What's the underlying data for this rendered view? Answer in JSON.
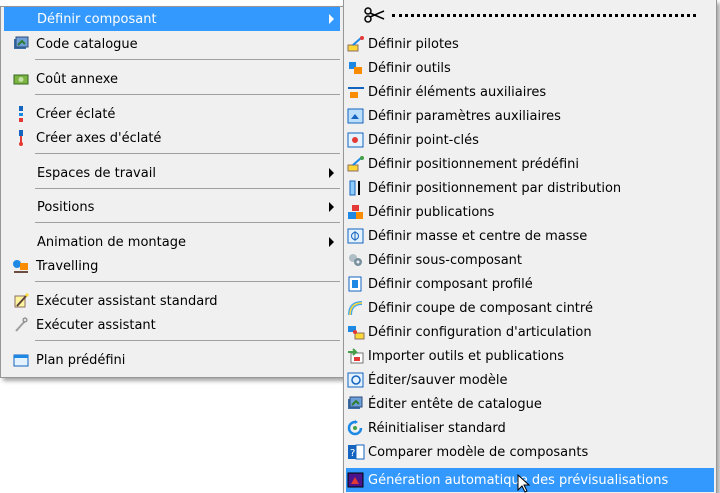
{
  "main_menu": {
    "items": [
      {
        "label": "Définir composant",
        "icon": "none",
        "submenu": true,
        "highlighted": true
      },
      {
        "label": "Code catalogue",
        "icon": "catalog-icon"
      },
      {
        "label": "Coût annexe",
        "icon": "money-icon"
      },
      {
        "label": "Créer éclaté",
        "icon": "explode-icon"
      },
      {
        "label": "Créer axes d'éclaté",
        "icon": "explode-axis-icon"
      },
      {
        "label": "Espaces de travail",
        "icon": "none",
        "submenu": true
      },
      {
        "label": "Positions",
        "icon": "none",
        "submenu": true
      },
      {
        "label": "Animation de montage",
        "icon": "none",
        "submenu": true
      },
      {
        "label": "Travelling",
        "icon": "travelling-icon"
      },
      {
        "label": "Exécuter assistant standard",
        "icon": "wizard-standard-icon"
      },
      {
        "label": "Exécuter assistant",
        "icon": "wizard-icon"
      },
      {
        "label": "Plan prédéfini",
        "icon": "plan-icon"
      }
    ]
  },
  "sub_menu": {
    "items": [
      {
        "label": "Définir pilotes",
        "icon": "pilot-icon"
      },
      {
        "label": "Définir outils",
        "icon": "tools-icon"
      },
      {
        "label": "Définir éléments auxiliaires",
        "icon": "aux-elements-icon"
      },
      {
        "label": "Définir paramètres auxiliaires",
        "icon": "aux-params-icon"
      },
      {
        "label": "Définir point-clés",
        "icon": "keypoints-icon"
      },
      {
        "label": "Définir positionnement prédéfini",
        "icon": "predefined-position-icon"
      },
      {
        "label": "Définir positionnement par distribution",
        "icon": "distribution-icon"
      },
      {
        "label": "Définir publications",
        "icon": "publications-icon"
      },
      {
        "label": "Définir masse et centre de masse",
        "icon": "mass-icon"
      },
      {
        "label": "Définir sous-composant",
        "icon": "subcomponent-icon"
      },
      {
        "label": "Définir composant profilé",
        "icon": "profile-icon"
      },
      {
        "label": "Définir coupe de composant cintré",
        "icon": "bent-cut-icon"
      },
      {
        "label": "Définir configuration d'articulation",
        "icon": "joint-icon"
      },
      {
        "label": "Importer outils et publications",
        "icon": "import-icon"
      },
      {
        "label": "Éditer/sauver modèle",
        "icon": "edit-model-icon"
      },
      {
        "label": "Éditer entête de catalogue",
        "icon": "catalog-header-icon"
      },
      {
        "label": "Réinitialiser standard",
        "icon": "reset-icon"
      },
      {
        "label": "Comparer modèle de composants",
        "icon": "compare-icon"
      },
      {
        "label": "Génération automatique des prévisualisations",
        "icon": "preview-gen-icon",
        "highlighted": true
      }
    ]
  },
  "colors": {
    "highlight": "#3399ff",
    "menu_bg": "#f0f0f0",
    "separator": "#a0a0a0"
  }
}
